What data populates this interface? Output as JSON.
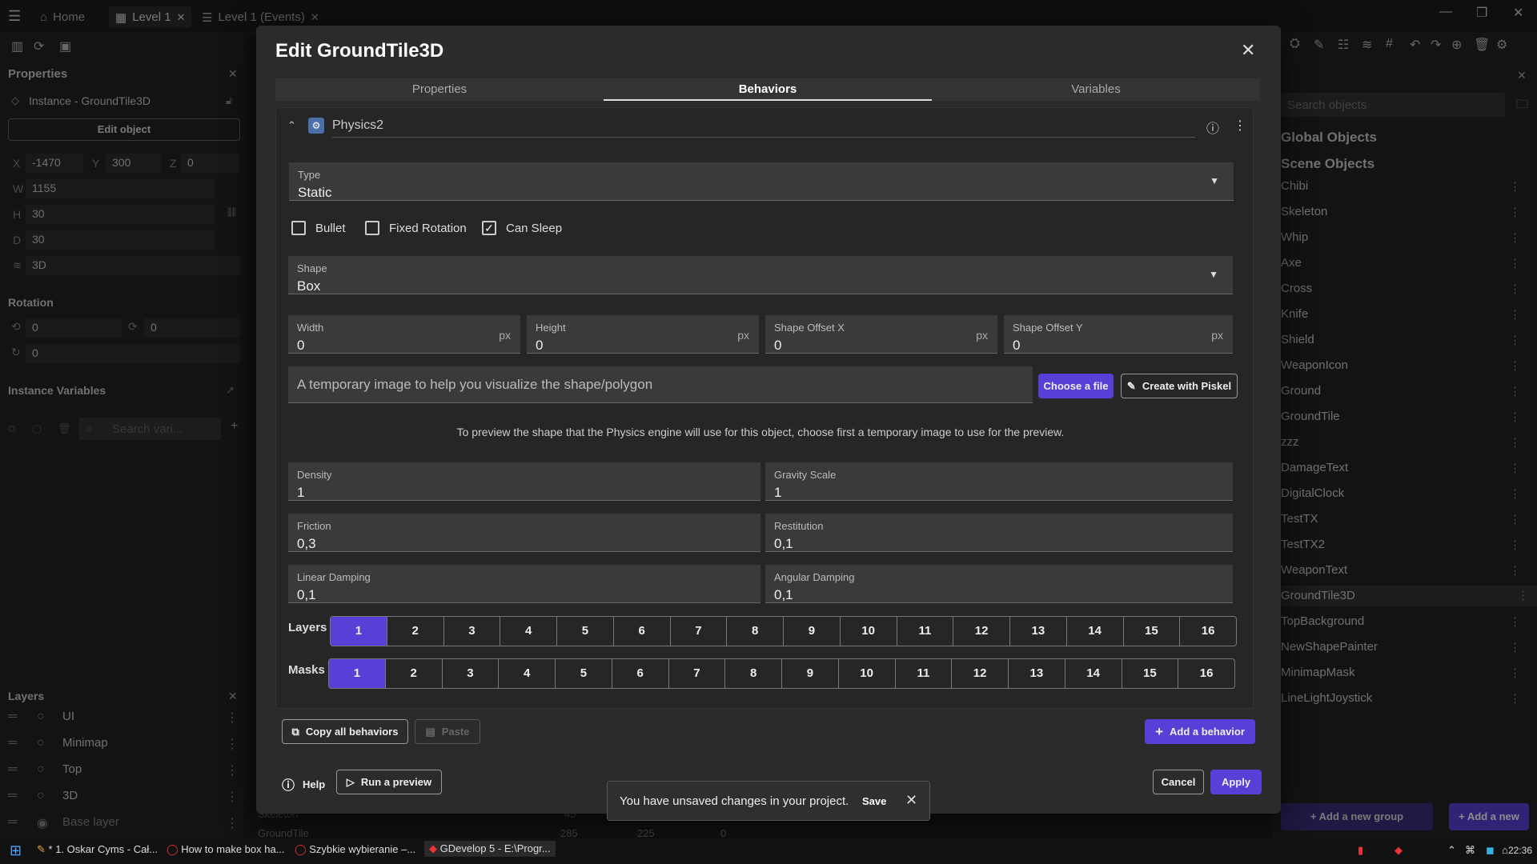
{
  "topbar": {
    "tabs": [
      {
        "label": "Home"
      },
      {
        "label": "Level 1"
      },
      {
        "label": "Level 1 (Events)"
      }
    ]
  },
  "left": {
    "properties_title": "Properties",
    "instance_label": "Instance - GroundTile3D",
    "edit_object": "Edit object",
    "x_label": "X",
    "x": "-1470",
    "y_label": "Y",
    "y": "300",
    "z_label": "Z",
    "z": "0",
    "w_label": "W",
    "w": "1155",
    "h_label": "H",
    "h": "30",
    "d_label": "D",
    "d": "30",
    "layer3d": "3D",
    "rotation_title": "Rotation",
    "rot1": "0",
    "rot2": "0",
    "rot3": "0",
    "instance_vars_title": "Instance Variables",
    "search_vars_placeholder": "Search vari...",
    "layers_title": "Layers",
    "layers": [
      {
        "label": "UI"
      },
      {
        "label": "Minimap"
      },
      {
        "label": "Top"
      },
      {
        "label": "3D"
      },
      {
        "label": "Base layer"
      }
    ],
    "under_rows": [
      {
        "label": "Skeleton",
        "a": "45",
        "b": "",
        "c": ""
      },
      {
        "label": "GroundTile",
        "a": "285",
        "b": "225",
        "c": "0"
      }
    ]
  },
  "right": {
    "search_placeholder": "Search objects",
    "global_title": "Global Objects",
    "scene_title": "Scene Objects",
    "objects": [
      {
        "label": "Chibi"
      },
      {
        "label": "Skeleton"
      },
      {
        "label": "Whip"
      },
      {
        "label": "Axe"
      },
      {
        "label": "Cross"
      },
      {
        "label": "Knife"
      },
      {
        "label": "Shield"
      },
      {
        "label": "WeaponIcon"
      },
      {
        "label": "Ground"
      },
      {
        "label": "GroundTile"
      },
      {
        "label": "zzz"
      },
      {
        "label": "DamageText"
      },
      {
        "label": "DigitalClock"
      },
      {
        "label": "TestTX"
      },
      {
        "label": "TestTX2"
      },
      {
        "label": "WeaponText"
      },
      {
        "label": "GroundTile3D"
      },
      {
        "label": "TopBackground"
      },
      {
        "label": "NewShapePainter"
      },
      {
        "label": "MinimapMask"
      },
      {
        "label": "LineLightJoystick"
      }
    ],
    "add_group": "Add a new group",
    "add_object": "Add a new object"
  },
  "dialog": {
    "title": "Edit GroundTile3D",
    "tabs": [
      {
        "label": "Properties"
      },
      {
        "label": "Behaviors"
      },
      {
        "label": "Variables"
      }
    ],
    "behavior_name": "Physics2",
    "type_label": "Type",
    "type_value": "Static",
    "bullet": "Bullet",
    "fixed_rotation": "Fixed Rotation",
    "can_sleep": "Can Sleep",
    "shape_label": "Shape",
    "shape_value": "Box",
    "width_label": "Width",
    "width": "0",
    "height_label": "Height",
    "height": "0",
    "offx_label": "Shape Offset X",
    "offx": "0",
    "offy_label": "Shape Offset Y",
    "offy": "0",
    "unit": "px",
    "image_placeholder": "A temporary image to help you visualize the shape/polygon",
    "choose_file": "Choose a file",
    "create_piskel": "Create with Piskel",
    "preview_hint": "To preview the shape that the Physics engine will use for this object, choose first a temporary image to use for the preview.",
    "density_label": "Density",
    "density": "1",
    "gravity_label": "Gravity Scale",
    "gravity": "1",
    "friction_label": "Friction",
    "friction": "0,3",
    "restitution_label": "Restitution",
    "restitution": "0,1",
    "lin_damp_label": "Linear Damping",
    "lin_damp": "0,1",
    "ang_damp_label": "Angular Damping",
    "ang_damp": "0,1",
    "layers_label": "Layers",
    "masks_label": "Masks",
    "layer_numbers": [
      "1",
      "2",
      "3",
      "4",
      "5",
      "6",
      "7",
      "8",
      "9",
      "10",
      "11",
      "12",
      "13",
      "14",
      "15",
      "16"
    ],
    "copy_all": "Copy all behaviors",
    "paste": "Paste",
    "add_behavior": "Add a behavior",
    "help": "Help",
    "run_preview": "Run a preview",
    "cancel": "Cancel",
    "apply": "Apply"
  },
  "toast": {
    "message": "You have unsaved changes in your project.",
    "save": "Save"
  },
  "taskbar": {
    "items": [
      {
        "label": "* 1. Oskar Cyms - Cał..."
      },
      {
        "label": "How to make box ha..."
      },
      {
        "label": "Szybkie wybieranie –..."
      },
      {
        "label": "GDevelop 5 - E:\\Progr..."
      }
    ],
    "time": "22:36"
  },
  "colors": {
    "accent": "#5a3fd6",
    "dialog_bg": "#2b2b2b",
    "panel_bg": "#242424"
  }
}
